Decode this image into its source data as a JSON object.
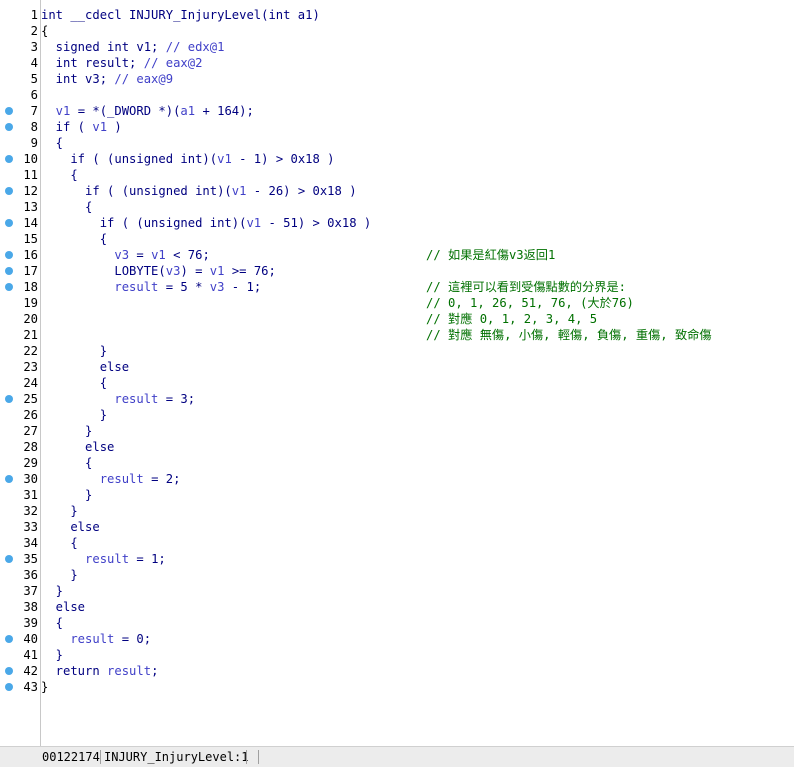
{
  "editor": {
    "lines": [
      {
        "n": "1",
        "bp": false,
        "segs": [
          [
            "kw",
            "int __cdecl INJURY_InjuryLevel(int a1)"
          ]
        ]
      },
      {
        "n": "2",
        "bp": false,
        "segs": [
          [
            "pl",
            "{"
          ]
        ]
      },
      {
        "n": "3",
        "bp": false,
        "segs": [
          [
            "kw",
            "  signed int v1; "
          ],
          [
            "vr",
            "// edx@1"
          ]
        ]
      },
      {
        "n": "4",
        "bp": false,
        "segs": [
          [
            "kw",
            "  int result; "
          ],
          [
            "vr",
            "// eax@2"
          ]
        ]
      },
      {
        "n": "5",
        "bp": false,
        "segs": [
          [
            "kw",
            "  int v3; "
          ],
          [
            "vr",
            "// eax@9"
          ]
        ]
      },
      {
        "n": "6",
        "bp": false,
        "segs": []
      },
      {
        "n": "7",
        "bp": true,
        "segs": [
          [
            "vr",
            "  v1"
          ],
          [
            "kw",
            " = *(_DWORD *)("
          ],
          [
            "vr",
            "a1"
          ],
          [
            "kw",
            " + 164);"
          ]
        ]
      },
      {
        "n": "8",
        "bp": true,
        "segs": [
          [
            "kw",
            "  if ( "
          ],
          [
            "vr",
            "v1"
          ],
          [
            "kw",
            " )"
          ]
        ]
      },
      {
        "n": "9",
        "bp": false,
        "segs": [
          [
            "kw",
            "  {"
          ]
        ]
      },
      {
        "n": "10",
        "bp": true,
        "segs": [
          [
            "kw",
            "    if ( (unsigned int)("
          ],
          [
            "vr",
            "v1"
          ],
          [
            "kw",
            " - 1) > 0x18 )"
          ]
        ]
      },
      {
        "n": "11",
        "bp": false,
        "segs": [
          [
            "kw",
            "    {"
          ]
        ]
      },
      {
        "n": "12",
        "bp": true,
        "segs": [
          [
            "kw",
            "      if ( (unsigned int)("
          ],
          [
            "vr",
            "v1"
          ],
          [
            "kw",
            " - 26) > 0x18 )"
          ]
        ]
      },
      {
        "n": "13",
        "bp": false,
        "segs": [
          [
            "kw",
            "      {"
          ]
        ]
      },
      {
        "n": "14",
        "bp": true,
        "segs": [
          [
            "kw",
            "        if ( (unsigned int)("
          ],
          [
            "vr",
            "v1"
          ],
          [
            "kw",
            " - 51) > 0x18 )"
          ]
        ]
      },
      {
        "n": "15",
        "bp": false,
        "segs": [
          [
            "kw",
            "        {"
          ]
        ]
      },
      {
        "n": "16",
        "bp": true,
        "segs": [
          [
            "vr",
            "          v3"
          ],
          [
            "kw",
            " = "
          ],
          [
            "vr",
            "v1"
          ],
          [
            "kw",
            " < 76;"
          ]
        ],
        "cmt": "// 如果是紅傷v3返回1"
      },
      {
        "n": "17",
        "bp": true,
        "segs": [
          [
            "kw",
            "          LOBYTE("
          ],
          [
            "vr",
            "v3"
          ],
          [
            "kw",
            ") = "
          ],
          [
            "vr",
            "v1"
          ],
          [
            "kw",
            " >= 76;"
          ]
        ]
      },
      {
        "n": "18",
        "bp": true,
        "segs": [
          [
            "vr",
            "          result"
          ],
          [
            "kw",
            " = 5 * "
          ],
          [
            "vr",
            "v3"
          ],
          [
            "kw",
            " - 1;"
          ]
        ],
        "cmt": "// 這裡可以看到受傷點數的分界是:"
      },
      {
        "n": "19",
        "bp": false,
        "segs": [],
        "cmt": "// 0, 1, 26, 51, 76, (大於76)"
      },
      {
        "n": "20",
        "bp": false,
        "segs": [],
        "cmt": "// 對應 0, 1, 2, 3, 4, 5"
      },
      {
        "n": "21",
        "bp": false,
        "segs": [],
        "cmt": "// 對應 無傷, 小傷, 輕傷, 負傷, 重傷, 致命傷"
      },
      {
        "n": "22",
        "bp": false,
        "segs": [
          [
            "kw",
            "        }"
          ]
        ]
      },
      {
        "n": "23",
        "bp": false,
        "segs": [
          [
            "kw",
            "        else"
          ]
        ]
      },
      {
        "n": "24",
        "bp": false,
        "segs": [
          [
            "kw",
            "        {"
          ]
        ]
      },
      {
        "n": "25",
        "bp": true,
        "segs": [
          [
            "vr",
            "          result"
          ],
          [
            "kw",
            " = 3;"
          ]
        ]
      },
      {
        "n": "26",
        "bp": false,
        "segs": [
          [
            "kw",
            "        }"
          ]
        ]
      },
      {
        "n": "27",
        "bp": false,
        "segs": [
          [
            "kw",
            "      }"
          ]
        ]
      },
      {
        "n": "28",
        "bp": false,
        "segs": [
          [
            "kw",
            "      else"
          ]
        ]
      },
      {
        "n": "29",
        "bp": false,
        "segs": [
          [
            "kw",
            "      {"
          ]
        ]
      },
      {
        "n": "30",
        "bp": true,
        "segs": [
          [
            "vr",
            "        result"
          ],
          [
            "kw",
            " = 2;"
          ]
        ]
      },
      {
        "n": "31",
        "bp": false,
        "segs": [
          [
            "kw",
            "      }"
          ]
        ]
      },
      {
        "n": "32",
        "bp": false,
        "segs": [
          [
            "kw",
            "    }"
          ]
        ]
      },
      {
        "n": "33",
        "bp": false,
        "segs": [
          [
            "kw",
            "    else"
          ]
        ]
      },
      {
        "n": "34",
        "bp": false,
        "segs": [
          [
            "kw",
            "    {"
          ]
        ]
      },
      {
        "n": "35",
        "bp": true,
        "segs": [
          [
            "vr",
            "      result"
          ],
          [
            "kw",
            " = 1;"
          ]
        ]
      },
      {
        "n": "36",
        "bp": false,
        "segs": [
          [
            "kw",
            "    }"
          ]
        ]
      },
      {
        "n": "37",
        "bp": false,
        "segs": [
          [
            "kw",
            "  }"
          ]
        ]
      },
      {
        "n": "38",
        "bp": false,
        "segs": [
          [
            "kw",
            "  else"
          ]
        ]
      },
      {
        "n": "39",
        "bp": false,
        "segs": [
          [
            "kw",
            "  {"
          ]
        ]
      },
      {
        "n": "40",
        "bp": true,
        "segs": [
          [
            "vr",
            "    result"
          ],
          [
            "kw",
            " = 0;"
          ]
        ]
      },
      {
        "n": "41",
        "bp": false,
        "segs": [
          [
            "kw",
            "  }"
          ]
        ]
      },
      {
        "n": "42",
        "bp": true,
        "segs": [
          [
            "kw",
            "  return "
          ],
          [
            "vr",
            "result"
          ],
          [
            "kw",
            ";"
          ]
        ]
      },
      {
        "n": "43",
        "bp": true,
        "segs": [
          [
            "pl",
            "}"
          ]
        ]
      }
    ]
  },
  "statusbar": {
    "address": "00122174",
    "location": "INJURY_InjuryLevel:1"
  },
  "colors": {
    "keyword": "#000080",
    "variable": "#4040c8",
    "comment": "#007000",
    "breakpoint_dot": "#4aa8e8"
  }
}
